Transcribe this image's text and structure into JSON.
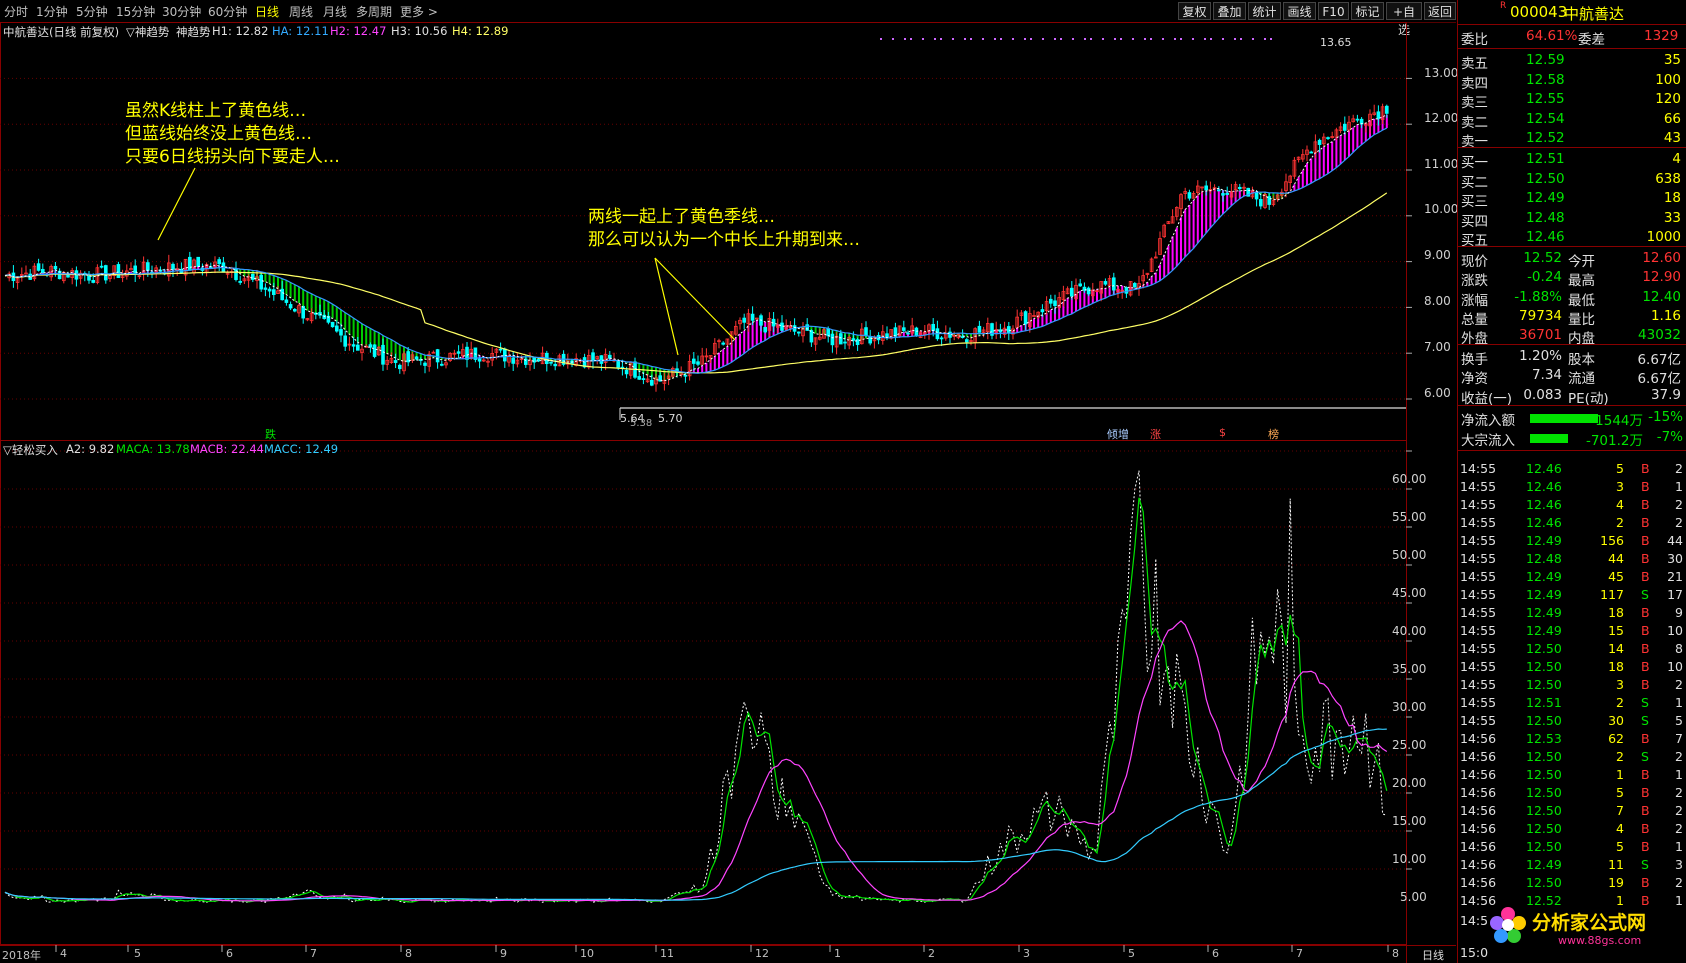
{
  "periods": [
    "分时",
    "1分钟",
    "5分钟",
    "15分钟",
    "30分钟",
    "60分钟",
    "日线",
    "周线",
    "月线",
    "多周期",
    "更多 >"
  ],
  "active_period": "日线",
  "toolbar": [
    "复权",
    "叠加",
    "统计",
    "画线",
    "F10",
    "标记",
    "+自选",
    "返回"
  ],
  "main_info": {
    "name": "中航善达(日线 前复权)",
    "indicator": "▽神趋势",
    "ind_name": "神趋势",
    "h1": "H1: 12.82",
    "ha": "HA: 12.11",
    "h2": "H2: 12.47",
    "h3": "H3: 10.56",
    "h4": "H4: 12.89"
  },
  "annotation1": [
    "虽然K线柱上了黄色线…",
    "但蓝线始终没上黄色线…",
    "只要6日线拐头向下要走人…"
  ],
  "annotation2": [
    "两线一起上了黄色季线…",
    "那么可以认为一个中长上升期到来…"
  ],
  "price_axis": [
    "13.00",
    "12.00",
    "11.00",
    "10.00",
    "9.00",
    "8.00",
    "7.00",
    "6.00"
  ],
  "high_label": "13.65",
  "low_label": "5.64",
  "low_label2": "5.70",
  "low_label3": "5.38",
  "signals": {
    "s1": "跌",
    "s2": "倾增",
    "s3": "涨",
    "s4": "$",
    "s5": "榜"
  },
  "sub_info": {
    "name": "▽轻松买入",
    "a2": "A2: 9.82",
    "maca": "MACA: 13.78",
    "macb": "MACB: 22.44",
    "macc": "MACC: 12.49"
  },
  "sub_axis": [
    "60.00",
    "55.00",
    "50.00",
    "45.00",
    "40.00",
    "35.00",
    "30.00",
    "25.00",
    "20.00",
    "15.00",
    "10.00",
    "5.00"
  ],
  "x_axis": [
    "2018年",
    "4",
    "5",
    "6",
    "7",
    "8",
    "9",
    "10",
    "11",
    "12",
    "1",
    "2",
    "3",
    "5",
    "6",
    "7",
    "8"
  ],
  "x_axis_right": "日线",
  "colors": {
    "red": "#ff3333",
    "green": "#00e400",
    "magenta": "#ff00ff",
    "yellow": "#ffff66",
    "blue": "#3399ff"
  },
  "chart_data": {
    "type": "line",
    "price_series": {
      "x": [
        0,
        40,
        80,
        120,
        160,
        200,
        240,
        280,
        320,
        360,
        400,
        440,
        480,
        520,
        560,
        600,
        640,
        680,
        720,
        760,
        800,
        840,
        880,
        920,
        960,
        1000,
        1040,
        1080,
        1120,
        1160,
        1200,
        1240,
        1280
      ],
      "close": [
        8.7,
        8.8,
        8.7,
        8.8,
        8.9,
        8.9,
        8.4,
        7.8,
        7.2,
        6.8,
        6.9,
        7.0,
        6.9,
        6.9,
        6.8,
        6.4,
        6.8,
        7.7,
        7.5,
        7.3,
        7.4,
        7.5,
        7.4,
        7.6,
        8.1,
        8.5,
        8.4,
        10.5,
        10.6,
        10.3,
        11.6,
        12.1,
        12.5
      ]
    },
    "sub_series": {
      "a2": [
        2,
        1,
        1,
        2,
        1,
        1,
        1,
        2,
        1,
        1,
        1,
        1,
        1,
        1,
        1,
        1,
        3,
        27,
        14,
        2,
        1,
        1,
        1,
        10,
        15,
        8,
        55,
        30,
        8,
        45,
        25,
        30,
        10
      ]
    }
  },
  "right": {
    "code": "000043",
    "name": "中航善达",
    "ratio_label": "委比",
    "ratio_val": "64.61%",
    "diff_label": "委差",
    "diff_val": "1329",
    "sells": [
      [
        "卖五",
        "12.59",
        "35"
      ],
      [
        "卖四",
        "12.58",
        "100"
      ],
      [
        "卖三",
        "12.55",
        "120"
      ],
      [
        "卖二",
        "12.54",
        "66"
      ],
      [
        "卖一",
        "12.52",
        "43"
      ]
    ],
    "buys": [
      [
        "买一",
        "12.51",
        "4"
      ],
      [
        "买二",
        "12.50",
        "638"
      ],
      [
        "买三",
        "12.49",
        "18"
      ],
      [
        "买四",
        "12.48",
        "33"
      ],
      [
        "买五",
        "12.46",
        "1000"
      ]
    ],
    "stats": [
      [
        "现价",
        "12.52",
        "今开",
        "12.60"
      ],
      [
        "涨跌",
        "-0.24",
        "最高",
        "12.90"
      ],
      [
        "涨幅",
        "-1.88%",
        "最低",
        "12.40"
      ],
      [
        "总量",
        "79734",
        "量比",
        "1.16"
      ],
      [
        "外盘",
        "36701",
        "内盘",
        "43032"
      ]
    ],
    "stats2": [
      [
        "换手",
        "1.20%",
        "股本",
        "6.67亿"
      ],
      [
        "净资",
        "7.34",
        "流通",
        "6.67亿"
      ],
      [
        "收益(一)",
        "0.083",
        "PE(动)",
        "37.9"
      ]
    ],
    "flow": [
      [
        "净流入额",
        "-1544万",
        "-15%"
      ],
      [
        "大宗流入",
        "-701.2万",
        "-7%"
      ]
    ],
    "ticks": [
      [
        "14:55",
        "12.46",
        "5",
        "B",
        "2"
      ],
      [
        "14:55",
        "12.46",
        "3",
        "B",
        "1"
      ],
      [
        "14:55",
        "12.46",
        "4",
        "B",
        "2"
      ],
      [
        "14:55",
        "12.46",
        "2",
        "B",
        "2"
      ],
      [
        "14:55",
        "12.49",
        "156",
        "B",
        "44"
      ],
      [
        "14:55",
        "12.48",
        "44",
        "B",
        "30"
      ],
      [
        "14:55",
        "12.49",
        "45",
        "B",
        "21"
      ],
      [
        "14:55",
        "12.49",
        "117",
        "S",
        "17"
      ],
      [
        "14:55",
        "12.49",
        "18",
        "B",
        "9"
      ],
      [
        "14:55",
        "12.49",
        "15",
        "B",
        "10"
      ],
      [
        "14:55",
        "12.50",
        "14",
        "B",
        "8"
      ],
      [
        "14:55",
        "12.50",
        "18",
        "B",
        "10"
      ],
      [
        "14:55",
        "12.50",
        "3",
        "B",
        "2"
      ],
      [
        "14:55",
        "12.51",
        "2",
        "S",
        "1"
      ],
      [
        "14:55",
        "12.50",
        "30",
        "S",
        "5"
      ],
      [
        "14:56",
        "12.53",
        "62",
        "B",
        "7"
      ],
      [
        "14:56",
        "12.50",
        "2",
        "S",
        "2"
      ],
      [
        "14:56",
        "12.50",
        "1",
        "B",
        "1"
      ],
      [
        "14:56",
        "12.50",
        "5",
        "B",
        "2"
      ],
      [
        "14:56",
        "12.50",
        "7",
        "B",
        "2"
      ],
      [
        "14:56",
        "12.50",
        "4",
        "B",
        "2"
      ],
      [
        "14:56",
        "12.50",
        "5",
        "B",
        "1"
      ],
      [
        "14:56",
        "12.49",
        "11",
        "S",
        "3"
      ],
      [
        "14:56",
        "12.50",
        "19",
        "B",
        "2"
      ],
      [
        "14:56",
        "12.52",
        "1",
        "B",
        "1"
      ]
    ],
    "tick_cut": [
      "14:5",
      "15:0"
    ],
    "watermark": "分析家公式网",
    "watermark_url": "www.88gs.com"
  }
}
